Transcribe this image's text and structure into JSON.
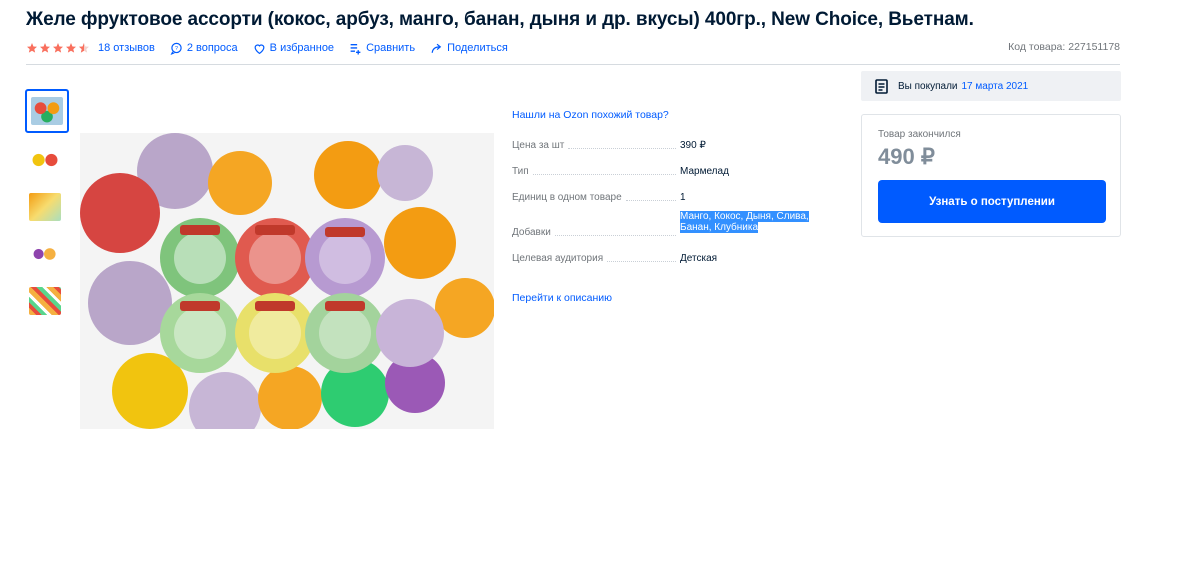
{
  "product": {
    "title": "Желе фруктовое ассорти (кокос, арбуз, манго, банан, дыня и др. вкусы) 400гр., New Choice, Вьетнам.",
    "rating": 4.5,
    "reviews_label": "18 отзывов",
    "questions_label": "2 вопроса",
    "favorite_label": "В избранное",
    "compare_label": "Сравнить",
    "share_label": "Поделиться",
    "sku_label": "Код товара: 227151178"
  },
  "specs": {
    "similar_link": "Нашли на Ozon похожий товар?",
    "rows": [
      {
        "key": "Цена за шт",
        "value": "390 ₽"
      },
      {
        "key": "Тип",
        "value": "Мармелад"
      },
      {
        "key": "Единиц в одном товаре",
        "value": "1"
      },
      {
        "key": "Добавки",
        "value_line1": "Манго, Кокос, Дыня, Слива,",
        "value_line2": "Банан, Клубника"
      },
      {
        "key": "Целевая аудитория",
        "value": "Детская"
      }
    ],
    "to_description": "Перейти к описанию"
  },
  "purchase": {
    "bought_prefix": "Вы покупали",
    "bought_date": "17 марта 2021",
    "status": "Товар закончился",
    "price": "490 ₽",
    "notify_button": "Узнать о поступлении"
  },
  "colors": {
    "accent": "#005bff",
    "star": "#f96f5d",
    "selection": "#3390ff"
  }
}
